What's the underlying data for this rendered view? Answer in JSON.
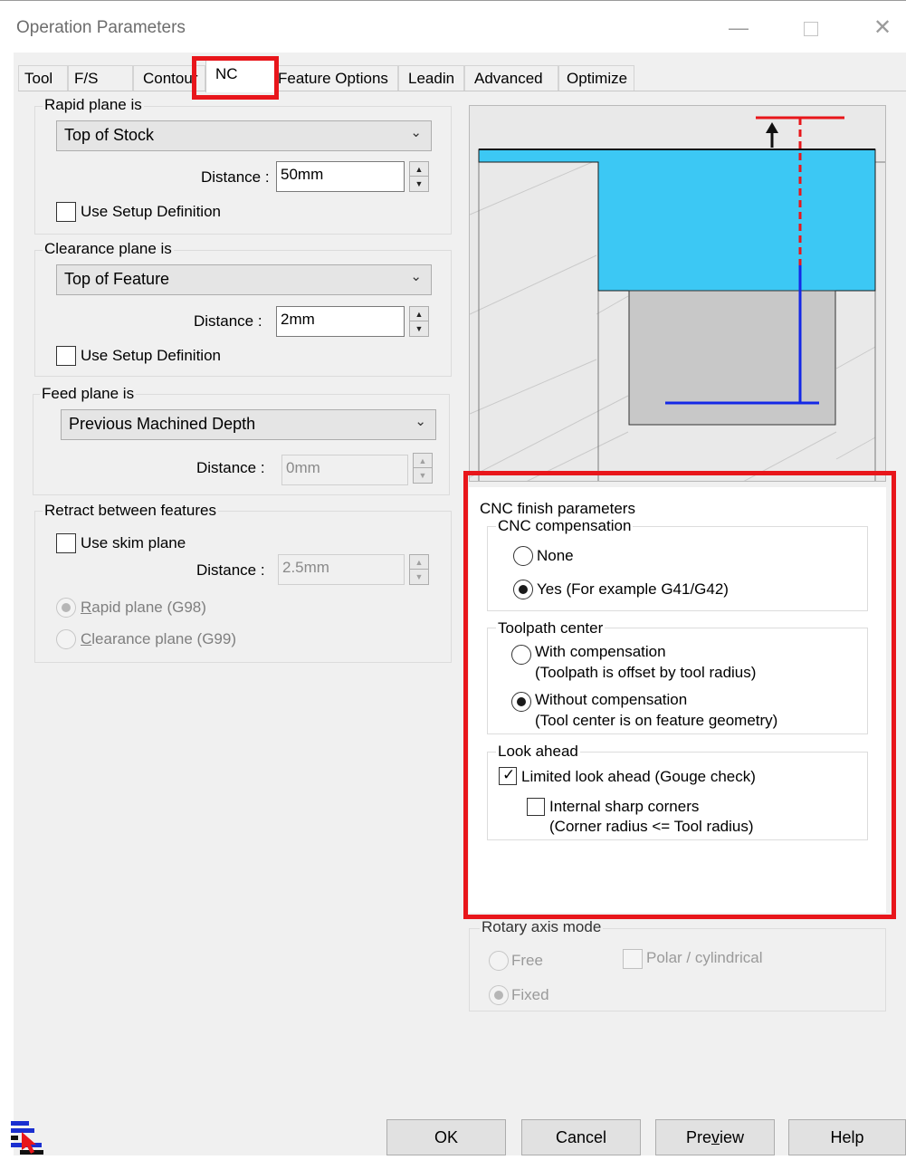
{
  "window": {
    "title": "Operation Parameters",
    "minimize_icon": "minimize-icon",
    "maximize_icon": "maximize-icon",
    "close_icon": "close-icon"
  },
  "tabs": [
    {
      "label": "Tool"
    },
    {
      "label": "F/S"
    },
    {
      "label": "Contour"
    },
    {
      "label": "NC",
      "active": true
    },
    {
      "label": "Feature Options"
    },
    {
      "label": "Leadin"
    },
    {
      "label": "Advanced"
    },
    {
      "label": "Optimize"
    }
  ],
  "rapid": {
    "group_label": "Rapid plane is",
    "selected": "Top of Stock",
    "distance_label": "Distance :",
    "distance_value": "50mm",
    "use_setup_label": "Use Setup Definition",
    "use_setup_checked": false
  },
  "clearance": {
    "group_label": "Clearance plane is",
    "selected": "Top of Feature",
    "distance_label": "Distance :",
    "distance_value": "2mm",
    "use_setup_label": "Use Setup Definition",
    "use_setup_checked": false
  },
  "feed": {
    "group_label": "Feed plane is",
    "selected": "Previous Machined Depth",
    "distance_label": "Distance :",
    "distance_value": "0mm"
  },
  "retract": {
    "group_label": "Retract between features",
    "skim_label": "Use skim plane",
    "skim_checked": false,
    "distance_label": "Distance :",
    "distance_value": "2.5mm",
    "rapid_option_prefix": "R",
    "rapid_option_rest": "apid plane (G98)",
    "clearance_option_prefix": "C",
    "clearance_option_rest": "learance plane (G99)",
    "selected": "rapid"
  },
  "cnc": {
    "group_label": "CNC finish parameters",
    "compensation": {
      "label": "CNC compensation",
      "none_label": "None",
      "yes_label": "Yes (For example G41/G42)",
      "selected": "yes"
    },
    "toolpath_center": {
      "label": "Toolpath center",
      "with_line1": "With compensation",
      "with_line2": "(Toolpath is offset by tool radius)",
      "without_line1": "Without compensation",
      "without_line2": "(Tool center is on feature geometry)",
      "selected": "without"
    },
    "look_ahead": {
      "label": "Look ahead",
      "limited_label": "Limited look ahead (Gouge check)",
      "limited_checked": true,
      "sharp_line1": "Internal sharp corners",
      "sharp_line2": "(Corner radius <= Tool radius)",
      "sharp_checked": false
    }
  },
  "rotary": {
    "group_label": "Rotary axis mode",
    "free_label": "Free",
    "fixed_label": "Fixed",
    "polar_label": "Polar / cylindrical",
    "selected": "fixed"
  },
  "buttons": {
    "ok": "OK",
    "cancel": "Cancel",
    "preview_prefix": "Pre",
    "preview_underlined": "v",
    "preview_suffix": "iew",
    "help": "Help"
  },
  "colors": {
    "highlight_red": "#e8161b",
    "stock_blue": "#3cc8f4",
    "toolpath_blue": "#1428e6",
    "plane_red": "#e8161b"
  },
  "icons": {
    "app_icon": "nc-toolpath-icon",
    "combo_arrow": "chevron-down-icon"
  }
}
